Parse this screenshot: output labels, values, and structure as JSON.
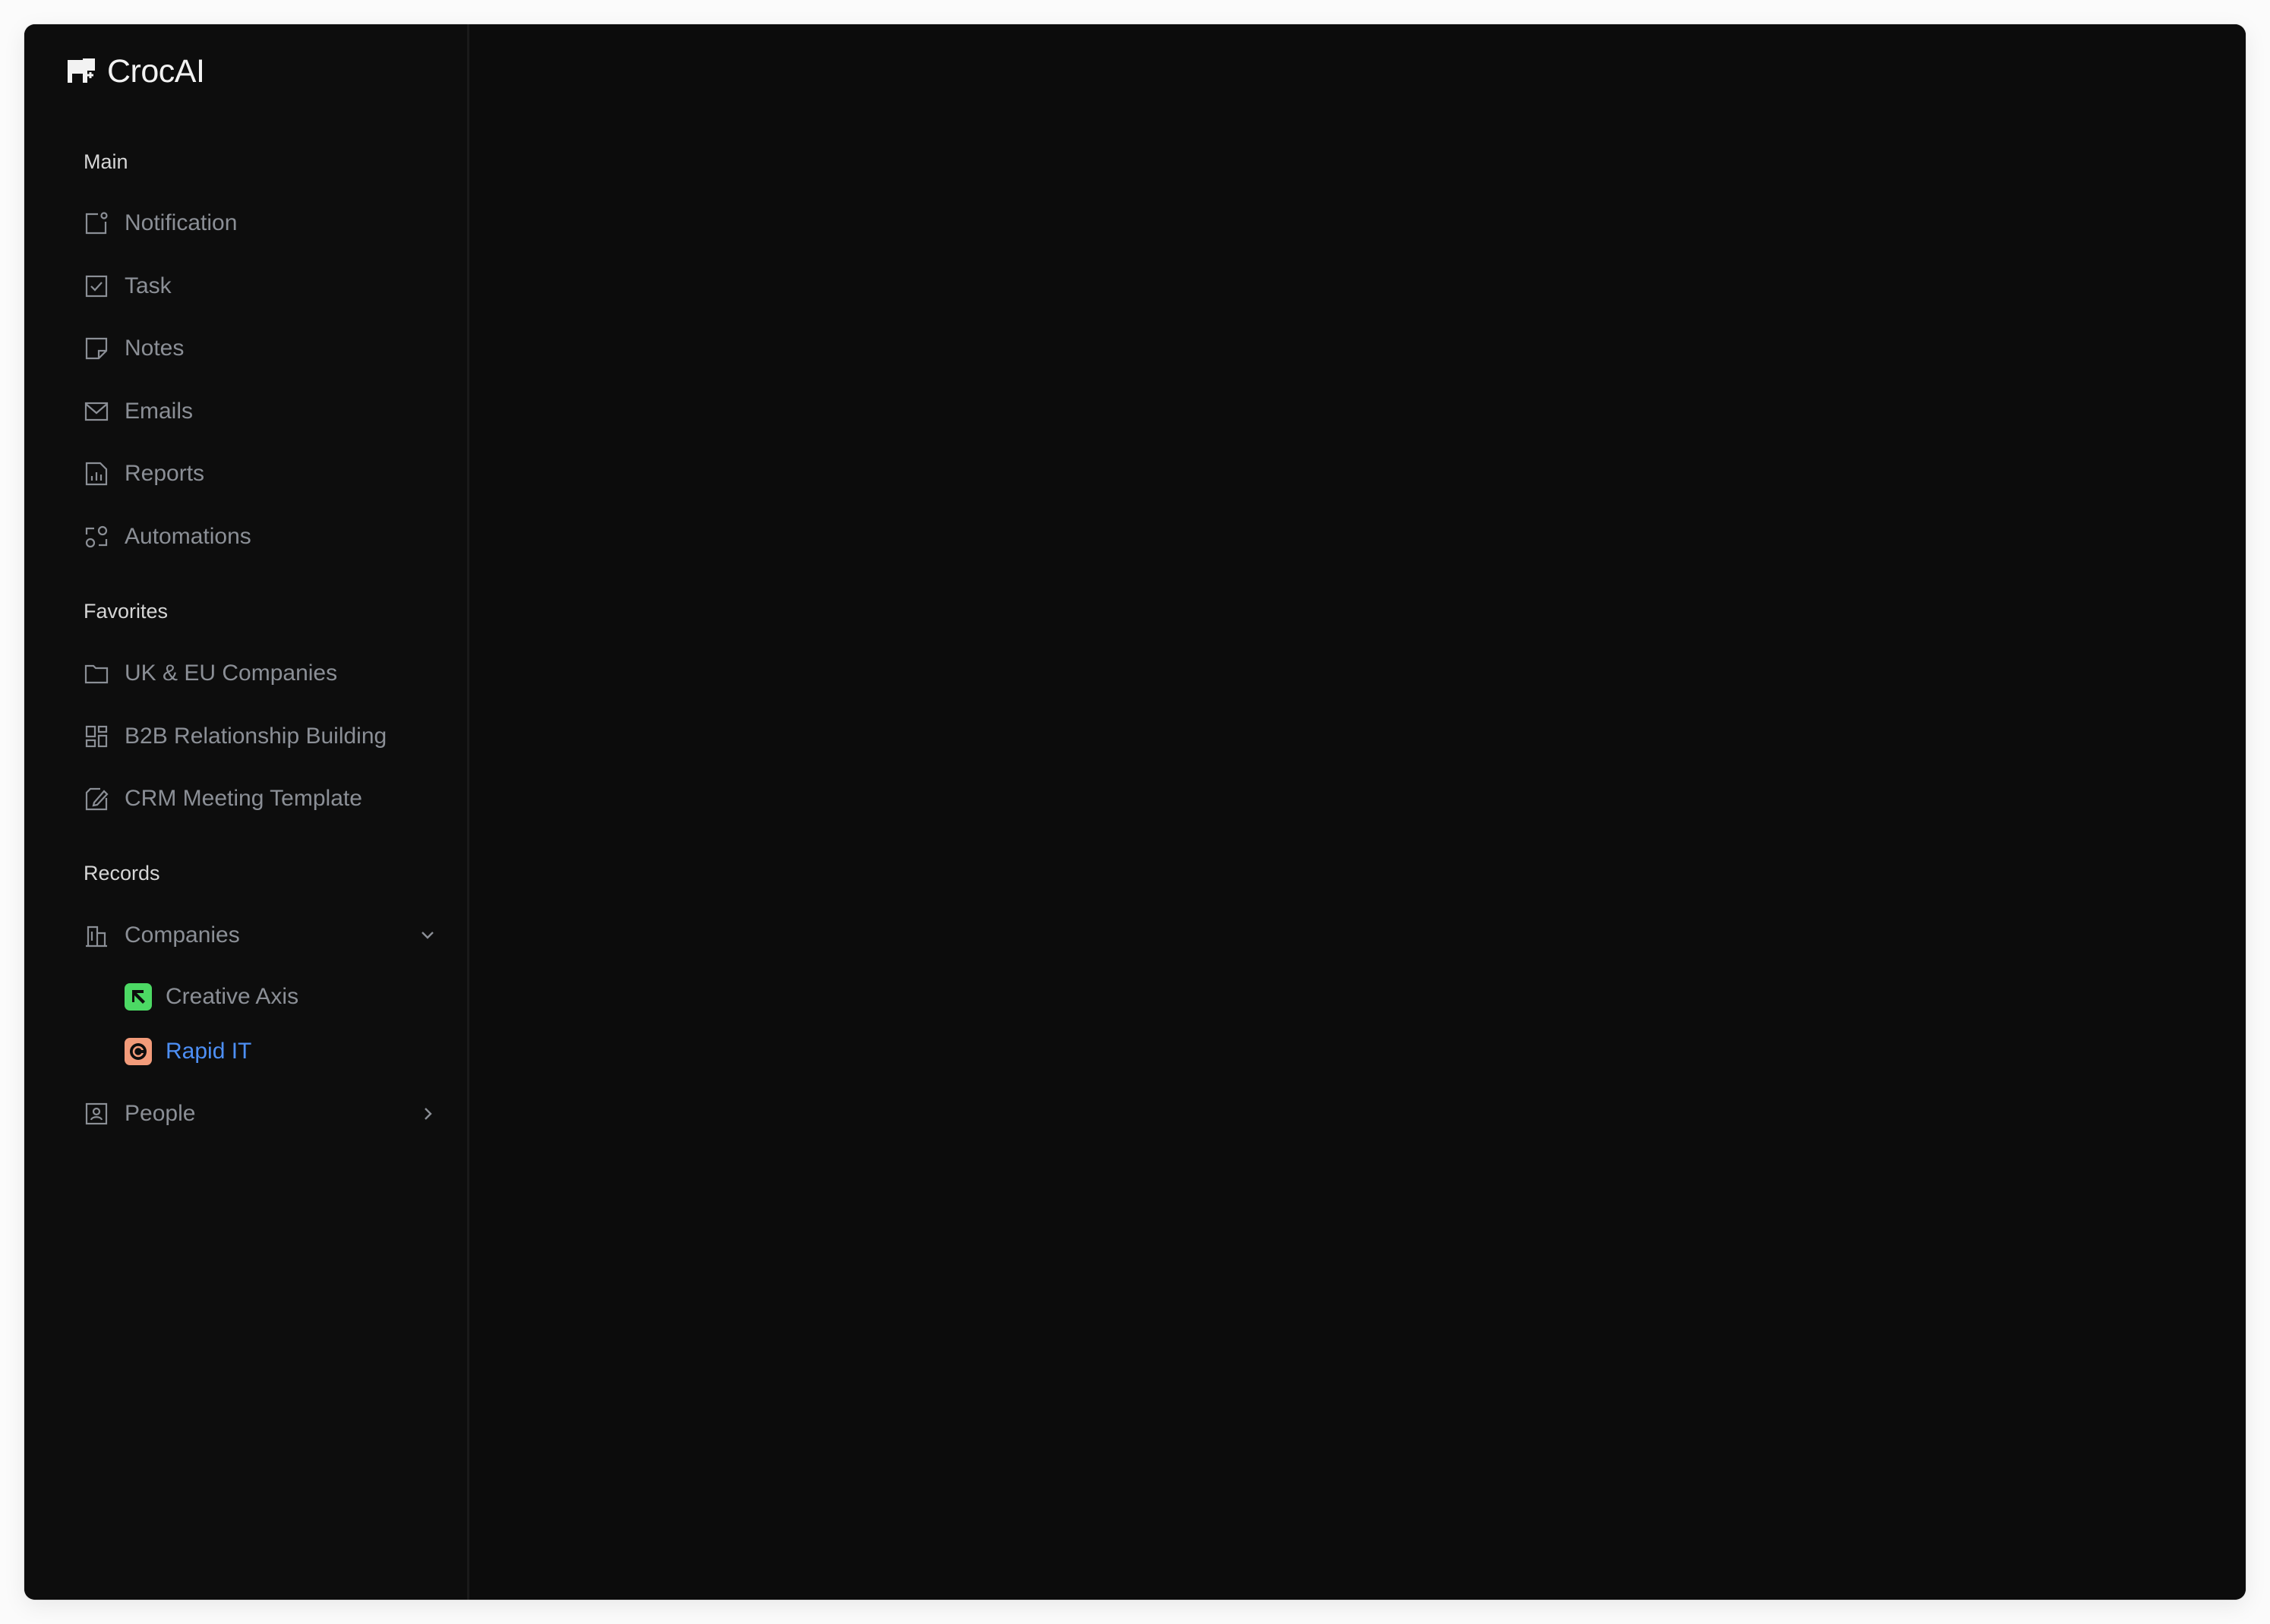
{
  "app": {
    "name": "CrocAI"
  },
  "colors": {
    "window_bg": "#0c0c0c",
    "text_muted": "#8b8f96",
    "section_label": "#d6d6d6",
    "active_link": "#4d8ff5",
    "creative_axis_badge": "#4cd964",
    "rapid_it_badge": "#f29b7a"
  },
  "sidebar": {
    "main_label": "Main",
    "main_items": [
      {
        "label": "Notification",
        "icon": "notification-icon"
      },
      {
        "label": "Task",
        "icon": "task-checkbox-icon"
      },
      {
        "label": "Notes",
        "icon": "note-icon"
      },
      {
        "label": "Emails",
        "icon": "mail-icon"
      },
      {
        "label": "Reports",
        "icon": "report-chart-icon"
      },
      {
        "label": "Automations",
        "icon": "automation-icon"
      }
    ],
    "favorites_label": "Favorites",
    "favorite_items": [
      {
        "label": "UK & EU Companies",
        "icon": "folder-icon"
      },
      {
        "label": "B2B Relationship Building",
        "icon": "grid-icon"
      },
      {
        "label": "CRM Meeting Template",
        "icon": "edit-document-icon"
      }
    ],
    "records_label": "Records",
    "companies": {
      "label": "Companies",
      "icon": "building-icon",
      "expanded": true,
      "children": [
        {
          "label": "Creative Axis",
          "icon": "creative-axis-logo",
          "active": false
        },
        {
          "label": "Rapid IT",
          "icon": "rapid-it-logo",
          "active": true
        }
      ]
    },
    "people": {
      "label": "People",
      "icon": "person-badge-icon",
      "expanded": false
    }
  }
}
